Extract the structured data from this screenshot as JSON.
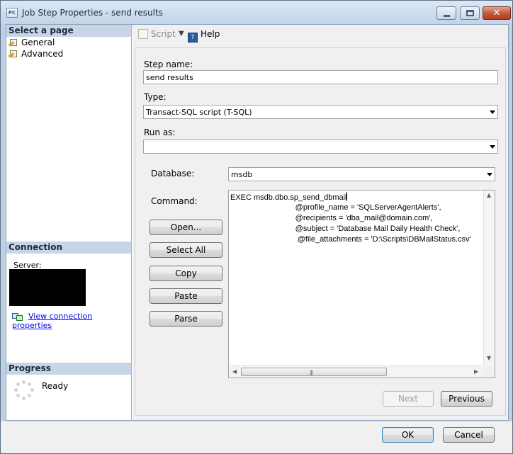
{
  "window": {
    "title": "Job Step Properties - send results",
    "app_icon_text": "PC"
  },
  "sidebar": {
    "select_page_header": "Select a page",
    "pages": [
      {
        "label": "General",
        "icon": "page-properties-icon"
      },
      {
        "label": "Advanced",
        "icon": "page-properties-icon"
      }
    ],
    "connection_header": "Connection",
    "server_label": "Server:",
    "view_connection_link": "View connection properties",
    "progress_header": "Progress",
    "progress_status": "Ready"
  },
  "toolbar": {
    "script_label": "Script",
    "help_label": "Help"
  },
  "form": {
    "step_name_label": "Step name:",
    "step_name_value": "send results",
    "type_label": "Type:",
    "type_value": "Transact-SQL script (T-SQL)",
    "run_as_label": "Run as:",
    "run_as_value": "",
    "database_label": "Database:",
    "database_value": "msdb",
    "command_label": "Command:",
    "command_lines": [
      "EXEC msdb.dbo.sp_send_dbmail",
      "                              @profile_name = 'SQLServerAgentAlerts',",
      "                              @recipients = 'dba_mail@domain.com',",
      "                              @subject = 'Database Mail Daily Health Check',",
      "                               @file_attachments = 'D:\\Scripts\\DBMailStatus.csv'"
    ],
    "buttons": {
      "open": "Open...",
      "select_all": "Select All",
      "copy": "Copy",
      "paste": "Paste",
      "parse": "Parse"
    },
    "next": "Next",
    "previous": "Previous"
  },
  "footer": {
    "ok": "OK",
    "cancel": "Cancel"
  }
}
